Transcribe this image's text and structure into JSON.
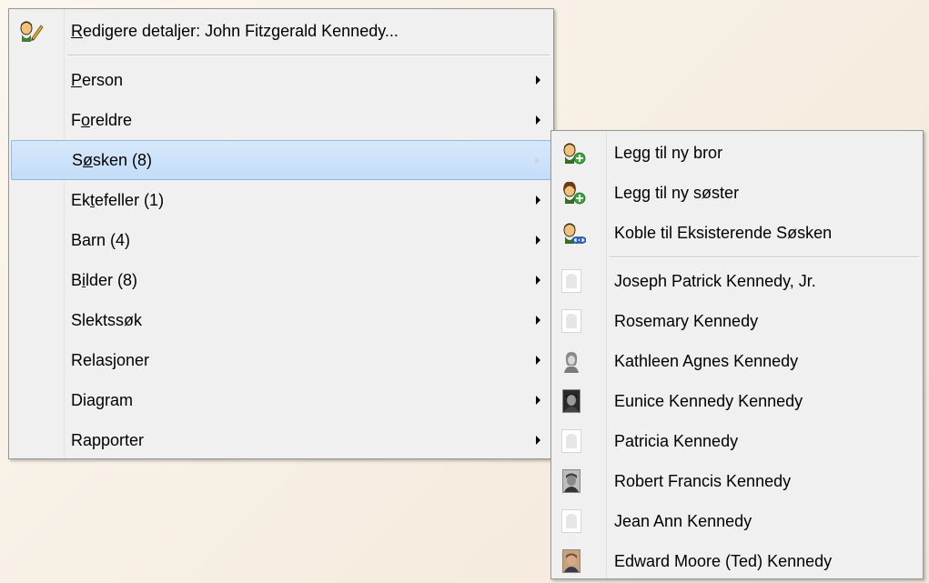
{
  "main_menu": {
    "edit_label_prefix": "R",
    "edit_label_rest": "edigere detaljer: John Fitzgerald Kennedy...",
    "items": [
      {
        "pre": "",
        "key": "P",
        "post": "erson"
      },
      {
        "pre": "F",
        "key": "o",
        "post": "reldre"
      },
      {
        "pre": "S",
        "key": "ø",
        "post": "sken (8)"
      },
      {
        "pre": "Ek",
        "key": "t",
        "post": "efeller (1)"
      },
      {
        "pre": "",
        "key": "",
        "post": "Barn (4)"
      },
      {
        "pre": "B",
        "key": "i",
        "post": "lder (8)"
      },
      {
        "pre": "",
        "key": "",
        "post": "Slektssøk"
      },
      {
        "pre": "",
        "key": "",
        "post": "Relasjoner"
      },
      {
        "pre": "",
        "key": "",
        "post": "Diagram"
      },
      {
        "pre": "",
        "key": "",
        "post": "Rapporter"
      }
    ]
  },
  "submenu": {
    "actions": [
      {
        "label": "Legg til ny bror",
        "icon": "add-brother-icon"
      },
      {
        "label": "Legg til ny søster",
        "icon": "add-sister-icon"
      },
      {
        "label": "Koble til Eksisterende Søsken",
        "icon": "link-sibling-icon"
      }
    ],
    "siblings": [
      {
        "name": "Joseph Patrick Kennedy, Jr.",
        "photo": "placeholder"
      },
      {
        "name": "Rosemary Kennedy",
        "photo": "placeholder"
      },
      {
        "name": "Kathleen Agnes Kennedy",
        "photo": "sketch"
      },
      {
        "name": "Eunice Kennedy Kennedy",
        "photo": "bw-photo"
      },
      {
        "name": "Patricia Kennedy",
        "photo": "placeholder"
      },
      {
        "name": "Robert Francis Kennedy",
        "photo": "bw-photo"
      },
      {
        "name": "Jean Ann Kennedy",
        "photo": "placeholder"
      },
      {
        "name": "Edward Moore (Ted) Kennedy",
        "photo": "color-photo"
      }
    ]
  },
  "colors": {
    "highlight": "#c3ddf8",
    "highlight_border": "#8fb8e7",
    "menu_bg": "#f0f0f0"
  }
}
